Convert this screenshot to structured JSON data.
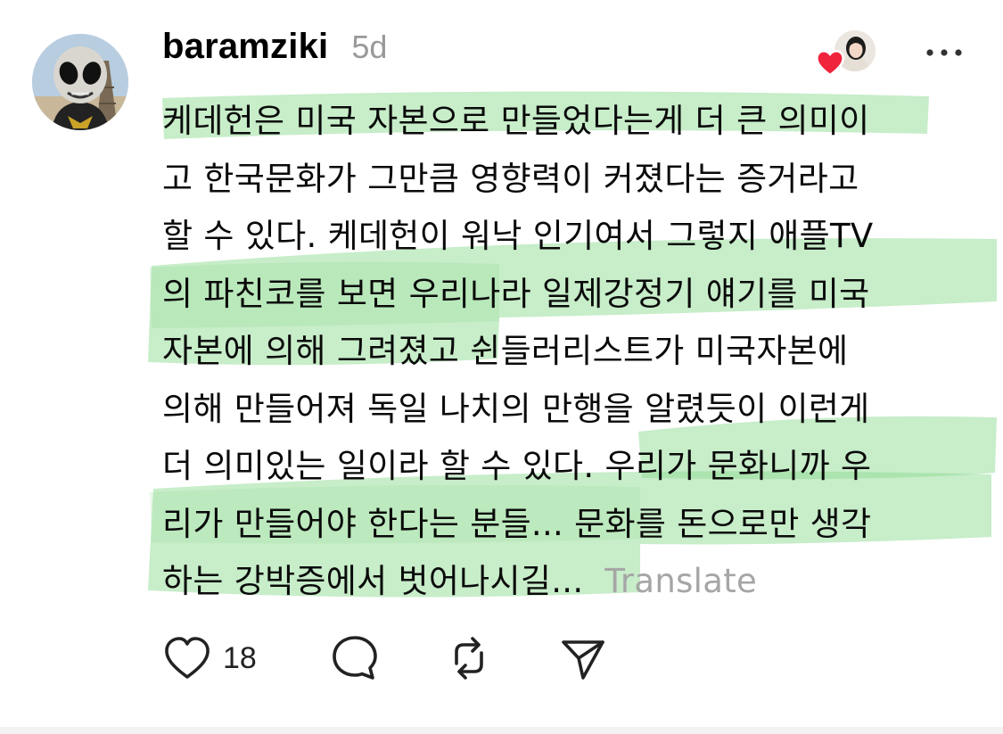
{
  "post": {
    "username": "baramziki",
    "timestamp": "5d",
    "body_lines": [
      "케데헌은 미국 자본으로 만들었다는게 더 큰 의미이",
      "고 한국문화가 그만큼 영향력이 커졌다는 증거라고",
      "할 수 있다. 케데헌이 워낙 인기여서 그렇지 애플TV",
      "의 파친코를 보면 우리나라 일제강정기 얘기를 미국",
      "자본에 의해 그려졌고 쉰들러리스트가 미국자본에",
      "의해 만들어져 독일 나치의 만행을 알렸듯이 이런게",
      "더 의미있는 일이라 할 수 있다. 우리가 문화니까 우",
      "리가 만들어야 한다는 분들... 문화를 돈으로만 생각",
      "하는 강박증에서 벗어나시길..."
    ],
    "translate_label": "Translate",
    "like_count": "18"
  },
  "icons": {
    "more": "more-horizontal-icon",
    "like": "heart-outline-icon",
    "comment": "comment-bubble-icon",
    "repost": "repost-icon",
    "share": "send-icon",
    "liked_by": "red-heart-icon"
  },
  "colors": {
    "highlight": "#8fdc93",
    "heart": "#f0243c",
    "muted_text": "#999999"
  }
}
